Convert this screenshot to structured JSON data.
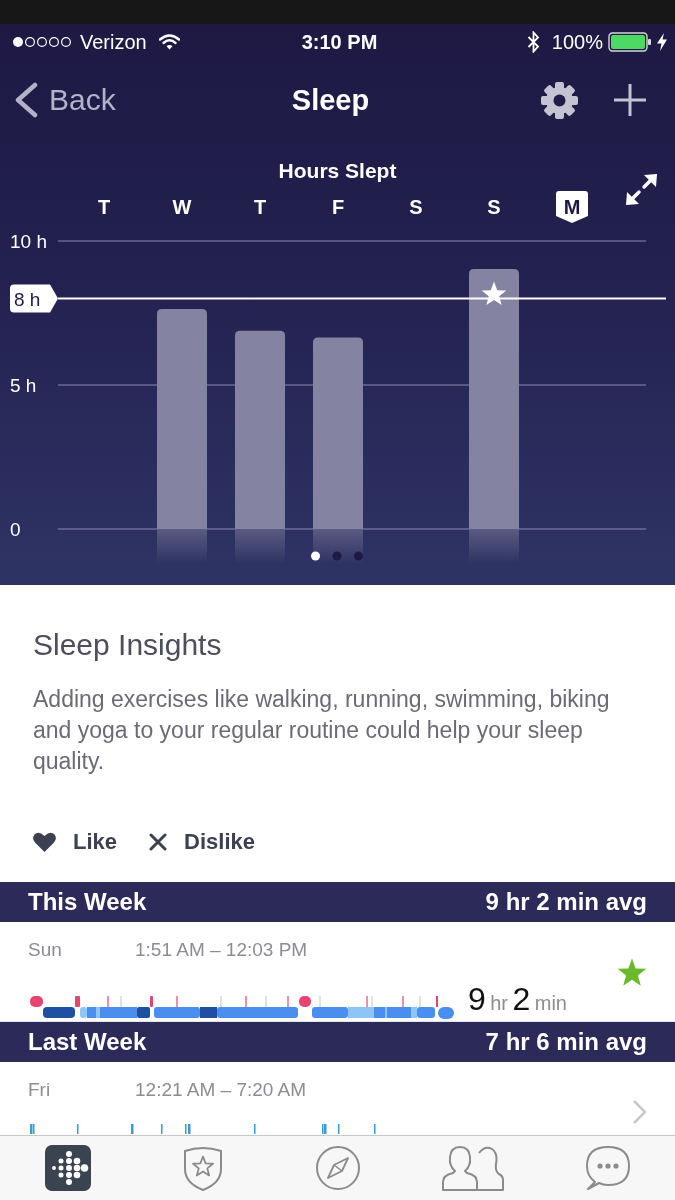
{
  "status_bar": {
    "carrier": "Verizon",
    "time": "3:10 PM",
    "battery": "100%"
  },
  "nav_bar": {
    "back": "Back",
    "title": "Sleep"
  },
  "chart_panel": {
    "chart_data": {
      "type": "bar",
      "title": "Hours Slept",
      "categories": [
        "T",
        "W",
        "T",
        "F",
        "S",
        "S",
        "M"
      ],
      "values": [
        null,
        7.64,
        6.88,
        6.65,
        null,
        9.03,
        null
      ],
      "ylim": [
        0,
        10
      ],
      "yticks": [
        {
          "value": 0,
          "label": "0"
        },
        {
          "value": 5,
          "label": "5 h"
        },
        {
          "value": 10,
          "label": "10 h"
        }
      ],
      "ref_lines": [
        {
          "axis": "y",
          "value": 8,
          "label": "8 h"
        }
      ]
    },
    "day_states": [
      {
        "selected": false
      },
      {
        "selected": false
      },
      {
        "selected": false
      },
      {
        "selected": false
      },
      {
        "selected": false
      },
      {
        "selected": false
      },
      {
        "selected": true
      }
    ],
    "pages": [
      {
        "selected": true
      },
      {
        "selected": false
      },
      {
        "selected": false
      }
    ]
  },
  "insights": {
    "title": "Sleep Insights",
    "text": "Adding exercises like walking, running, swimming, biking and yoga to your regular routine could help your sleep quality.",
    "like": "Like",
    "dislike": "Dislike"
  },
  "logs": [
    {
      "title": "This Week",
      "average": "9 hr 2 min avg",
      "entries": [
        {
          "day": "Sun",
          "time_range": "1:51 AM – 12:03 PM",
          "kind": "stages",
          "hours": "9",
          "hours_unit": "hr",
          "minutes": "2",
          "minutes_unit": "min",
          "goal_met": true
        }
      ]
    },
    {
      "title": "Last Week",
      "average": "7 hr 6 min avg",
      "entries": [
        {
          "day": "Fri",
          "time_range": "12:21 AM – 7:20 AM",
          "kind": "ticks",
          "goal_met": false
        }
      ]
    }
  ],
  "tab_bar": [
    {
      "selected": true
    },
    {
      "selected": false
    },
    {
      "selected": false
    },
    {
      "selected": false
    },
    {
      "selected": false
    }
  ]
}
